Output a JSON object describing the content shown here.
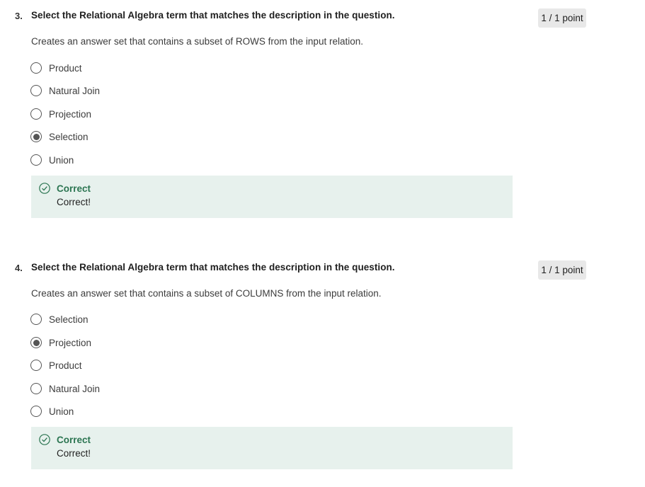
{
  "questions": [
    {
      "number": "3.",
      "prompt": "Select the Relational Algebra term that matches the description in the question.",
      "score": "1 / 1 point",
      "description": "Creates an answer set that contains a subset of ROWS from the input relation.",
      "options": [
        {
          "label": "Product",
          "selected": false
        },
        {
          "label": "Natural Join",
          "selected": false
        },
        {
          "label": "Projection",
          "selected": false
        },
        {
          "label": "Selection",
          "selected": true
        },
        {
          "label": "Union",
          "selected": false
        }
      ],
      "feedback": {
        "title": "Correct",
        "text": "Correct!",
        "icon": "check-circle-icon"
      }
    },
    {
      "number": "4.",
      "prompt": "Select the Relational Algebra term that matches the description in the question.",
      "score": "1 / 1 point",
      "description": "Creates an answer set that contains a subset of COLUMNS from the input relation.",
      "options": [
        {
          "label": "Selection",
          "selected": false
        },
        {
          "label": "Projection",
          "selected": true
        },
        {
          "label": "Product",
          "selected": false
        },
        {
          "label": "Natural Join",
          "selected": false
        },
        {
          "label": "Union",
          "selected": false
        }
      ],
      "feedback": {
        "title": "Correct",
        "text": "Correct!",
        "icon": "check-circle-icon"
      }
    }
  ],
  "colors": {
    "feedback_bg": "#e7f1ed",
    "correct_green": "#2b7551",
    "score_bg": "#e8e8e8",
    "radio": "#555555"
  }
}
